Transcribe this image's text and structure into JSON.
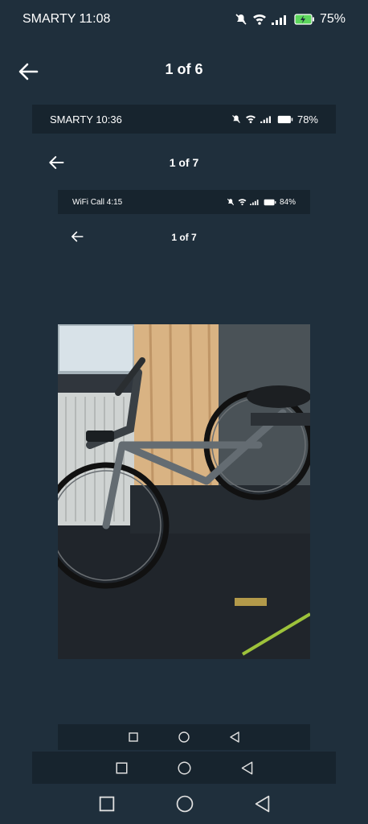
{
  "status_bar": {
    "carrier_time": "SMARTY 11:08",
    "battery": "75%"
  },
  "header": {
    "title": "1 of 6"
  },
  "nested1": {
    "status_carrier_time": "SMARTY 10:36",
    "status_battery": "78%",
    "title": "1 of 7"
  },
  "nested2": {
    "status_carrier_time": "WiFi Call 4:15",
    "status_battery": "84%",
    "title": "1 of 7"
  },
  "photo": {
    "subject": "bicycle-photo"
  },
  "colors": {
    "background": "#1f2f3c",
    "inner_bar": "#17242e",
    "battery_charging": "#5cd65c"
  },
  "nav_icons": [
    "square-icon",
    "circle-icon",
    "triangle-back-icon"
  ]
}
